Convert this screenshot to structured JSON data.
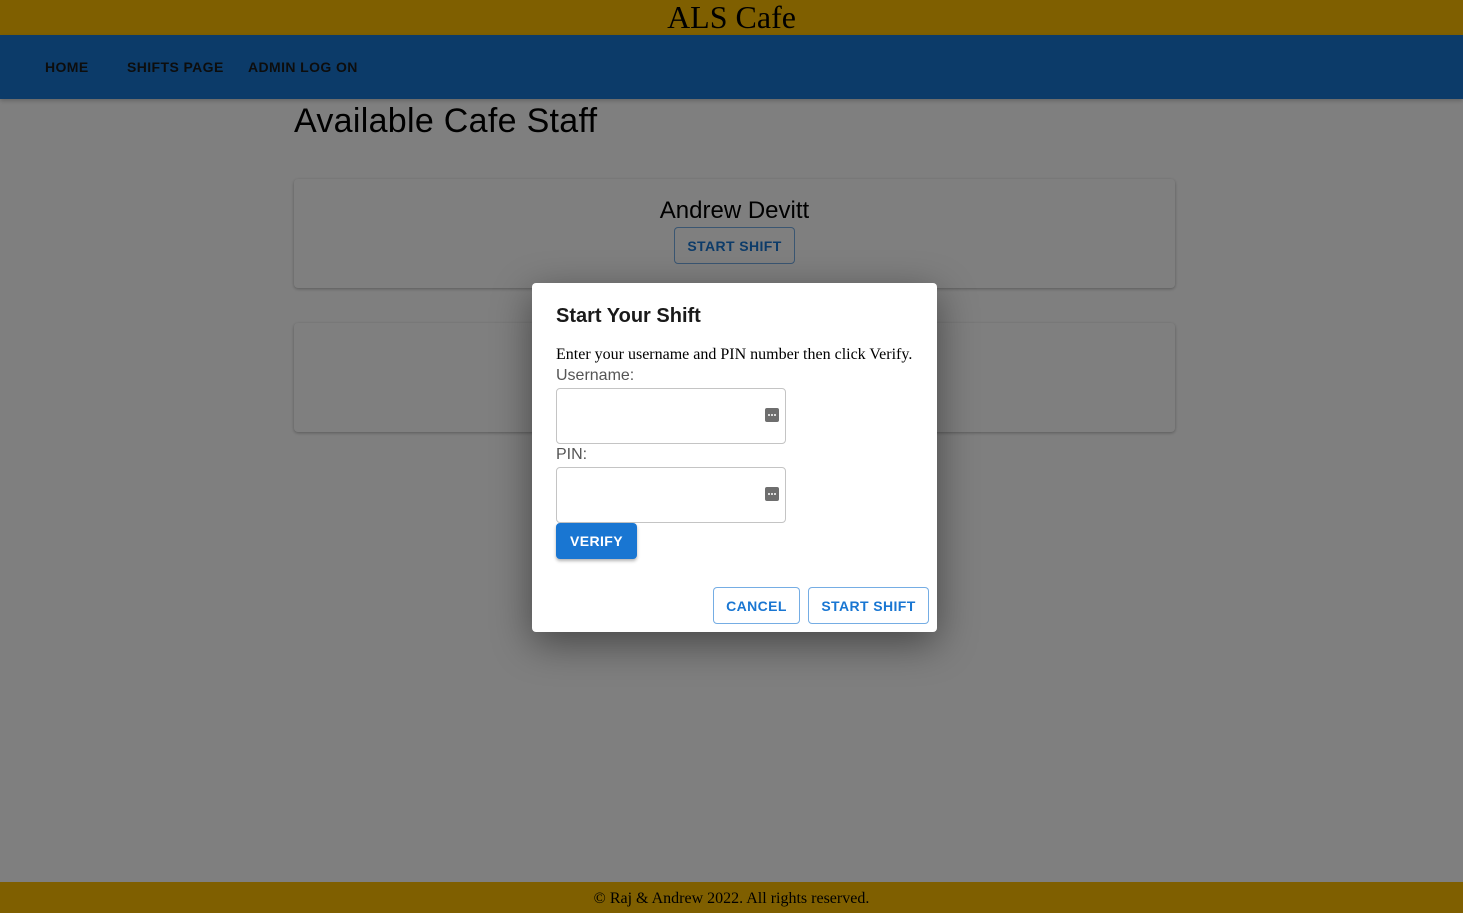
{
  "header": {
    "title": "ALS Cafe"
  },
  "nav": {
    "items": [
      {
        "label": "HOME"
      },
      {
        "label": "SHIFTS PAGE"
      },
      {
        "label": "ADMIN LOG ON"
      }
    ]
  },
  "main": {
    "title": "Available Cafe Staff",
    "staff": [
      {
        "name": "Andrew Devitt",
        "button_label": "START SHIFT"
      },
      {
        "name": "",
        "button_label": ""
      }
    ]
  },
  "dialog": {
    "title": "Start Your Shift",
    "instructions": "Enter your username and PIN number then click Verify.",
    "username_label": "Username:",
    "username_value": "",
    "pin_label": "PIN:",
    "pin_value": "",
    "verify_label": "VERIFY",
    "cancel_label": "CANCEL",
    "start_label": "START SHIFT",
    "password_manager_icon": "password-manager-icon"
  },
  "footer": {
    "text": "© Raj & Andrew 2022. All rights reserved."
  },
  "colors": {
    "top_bar": "#ffbf00",
    "nav_bar": "#1976d2",
    "primary": "#1976d2",
    "backdrop": "rgba(0,0,0,0.5)"
  }
}
